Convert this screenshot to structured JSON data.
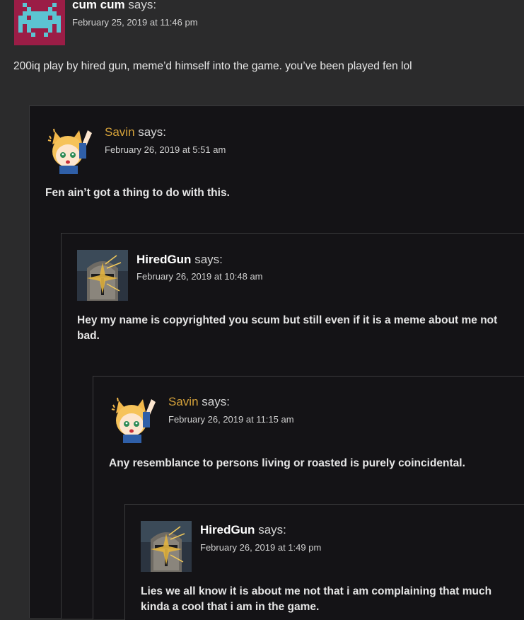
{
  "comments": [
    {
      "author": "cum cum",
      "says": "says:",
      "date": "February 25, 2019 at 11:46 pm",
      "text": "200iq play by hired gun, meme’d himself into the game. you’ve been played fen lol",
      "avatar": "pixel-invader-avatar"
    },
    {
      "author": "Savin",
      "says": "says:",
      "date": "February 26, 2019 at 5:51 am",
      "text": "Fen ain’t got a thing to do with this.",
      "avatar": "anime-girl-avatar"
    },
    {
      "author": "HiredGun",
      "says": "says:",
      "date": "February 26, 2019 at 10:48 am",
      "text": "Hey my name is copyrighted you scum but still even if it is a meme about me not bad.",
      "avatar": "knight-helmet-avatar"
    },
    {
      "author": "Savin",
      "says": "says:",
      "date": "February 26, 2019 at 11:15 am",
      "text": "Any resemblance to persons living or roasted is purely coincidental.",
      "avatar": "anime-girl-avatar"
    },
    {
      "author": "HiredGun",
      "says": "says:",
      "date": "February 26, 2019 at 1:49 pm",
      "text": "Lies we all know it is about me not that i am complaining that much kinda a cool that i am in the game.",
      "avatar": "knight-helmet-avatar"
    }
  ],
  "colors": {
    "page_bg": "#2b2b2c",
    "panel_bg": "#141316",
    "author_gold": "#d4a13a"
  }
}
